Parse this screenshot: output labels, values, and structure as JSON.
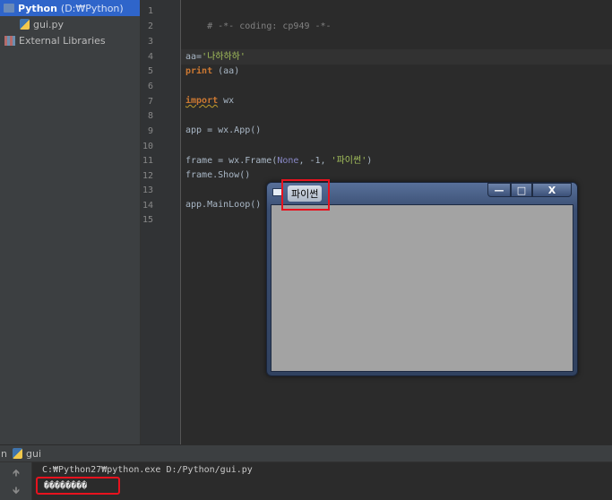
{
  "project_tree": {
    "root": {
      "name": "Python",
      "path": "(D:₩Python)"
    },
    "file": "gui.py",
    "libraries": "External Libraries"
  },
  "editor": {
    "line_numbers": [
      "1",
      "2",
      "3",
      "4",
      "5",
      "6",
      "7",
      "8",
      "9",
      "10",
      "11",
      "12",
      "13",
      "14",
      "15"
    ],
    "code": {
      "l1": "# -*- coding: cp949 -*-",
      "l4_var": "aa=",
      "l4_str": "'나하하하'",
      "l5_kw": "print",
      "l5_rest": " (aa)",
      "l7_kw": "import",
      "l7_rest": " wx",
      "l9": "app = wx.App()",
      "l11_pre": "frame = wx.Frame(",
      "l11_none": "None",
      "l11_mid": ", -1, ",
      "l11_str": "'파이썬'",
      "l11_post": ")",
      "l12": "frame.Show()",
      "l14": "app.MainLoop()"
    }
  },
  "wx_window": {
    "title": "파이썬",
    "minimize": "—",
    "maximize": "□",
    "close": "X"
  },
  "run_panel": {
    "tab_prefix": "n",
    "tab_label": "gui",
    "command": "C:₩Python27₩python.exe D:/Python/gui.py",
    "output": "��������"
  },
  "colors": {
    "annotation": "#e8121e",
    "selection": "#2f65ca"
  }
}
